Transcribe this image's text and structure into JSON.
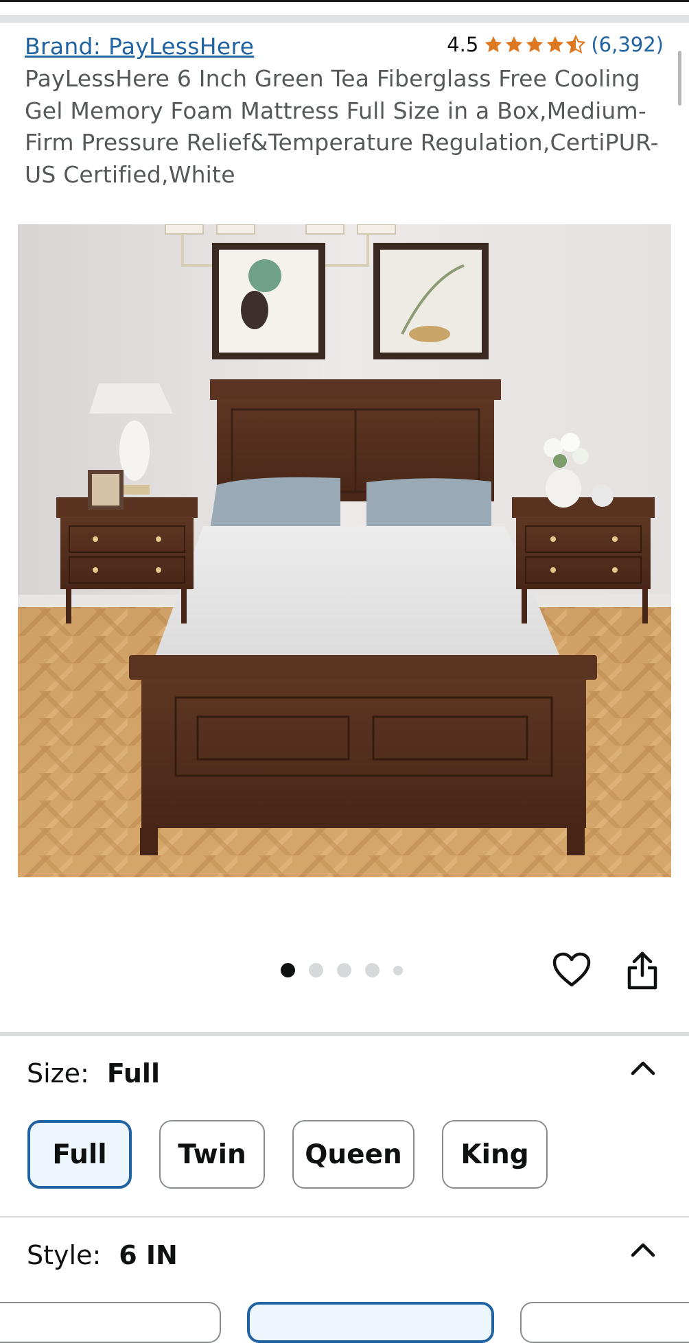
{
  "header": {
    "brand_link": "Brand: PayLessHere",
    "rating_value": "4.5",
    "rating_stars": 4.5,
    "rating_count": "(6,392)",
    "title": "PayLessHere 6 Inch Green Tea Fiberglass Free Cooling Gel Memory Foam Mattress Full Size in a Box,Medium-Firm Pressure Relief&Temperature Regulation,CertiPUR-US Certified,White"
  },
  "gallery": {
    "image_icon": "product-photo-bedroom",
    "image_count": 5,
    "active_index": 0,
    "favorite_icon": "heart-icon",
    "share_icon": "share-icon"
  },
  "size": {
    "label": "Size:",
    "selected": "Full",
    "options": [
      "Full",
      "Twin",
      "Queen",
      "King"
    ],
    "collapse_icon": "chevron-up-icon"
  },
  "style": {
    "label": "Style:",
    "selected": "6 IN",
    "collapse_icon": "chevron-up-icon"
  },
  "colors": {
    "link": "#2162a1",
    "star": "#de7921",
    "selected_border": "#2162a1",
    "selected_fill": "#edf5fd"
  }
}
